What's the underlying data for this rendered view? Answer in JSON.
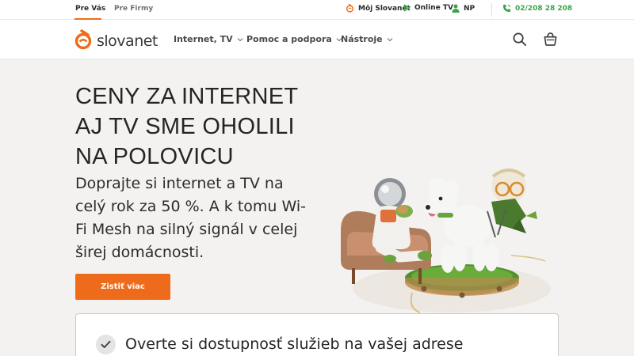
{
  "topbar": {
    "segments": [
      {
        "label": "Pre Vás",
        "active": true
      },
      {
        "label": "Pre Firmy",
        "active": false
      }
    ],
    "links": [
      {
        "label": "Môj Slovanet",
        "icon": "slovanet-logo-icon"
      },
      {
        "label": "Online TV",
        "icon": "play-icon"
      },
      {
        "label": "NP",
        "icon": "user-icon"
      }
    ],
    "phone": "02/208 28 208"
  },
  "nav": {
    "logo_text": "slovanet",
    "items": [
      {
        "label": "Internet, TV"
      },
      {
        "label": "Pomoc a podpora"
      },
      {
        "label": "Nástroje"
      }
    ],
    "icons": [
      "search-icon",
      "shopping-bag-icon"
    ]
  },
  "hero": {
    "title_lines": [
      "CENY ZA INTERNET",
      "AJ TV SME OHOLILI",
      "NA POLOVICU"
    ],
    "subtitle_lines": [
      "Doprajte si internet a TV na",
      "celý rok za 50 %. A k tomu Wi-",
      "Fi Mesh na silný signál v celej",
      "širej domácnosti."
    ],
    "cta_label": "Zistiť viac"
  },
  "card": {
    "title": "Overte si dostupnosť služieb na vašej adrese"
  },
  "colors": {
    "accent": "#ee6b1b",
    "phone": "#3aa54a",
    "background": "#f4f2f0"
  }
}
